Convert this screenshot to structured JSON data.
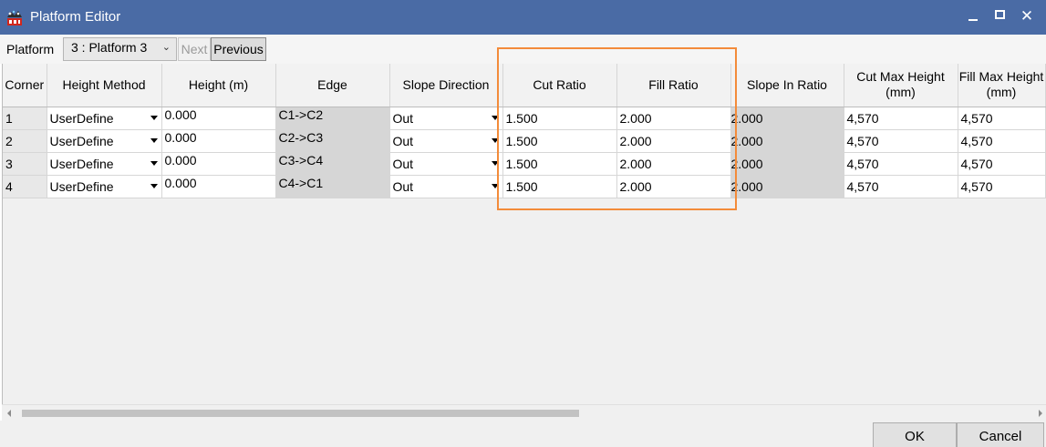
{
  "window": {
    "title": "Platform Editor",
    "close_glyph": "✕",
    "icon": "app-logo-icon"
  },
  "toolbar": {
    "platform_label": "Platform",
    "platform_value": "3 : Platform 3",
    "next_label": "Next",
    "previous_label": "Previous"
  },
  "grid": {
    "columns": [
      "Corner",
      "Height Method",
      "Height (m)",
      "Edge",
      "Slope Direction",
      "Cut Ratio",
      "Fill Ratio",
      "Slope In Ratio",
      "Cut Max Height\n(mm)",
      "Fill Max Height\n(mm)"
    ],
    "rows": [
      {
        "corner": "1",
        "height_method": "UserDefine",
        "height": "0.000",
        "edge": "C1->C2",
        "slope_direction": "Out",
        "cut_ratio": "1.500",
        "fill_ratio": "2.000",
        "slope_in_ratio": "2.000",
        "cut_max_height": "4,570",
        "fill_max_height": "4,570"
      },
      {
        "corner": "2",
        "height_method": "UserDefine",
        "height": "0.000",
        "edge": "C2->C3",
        "slope_direction": "Out",
        "cut_ratio": "1.500",
        "fill_ratio": "2.000",
        "slope_in_ratio": "2.000",
        "cut_max_height": "4,570",
        "fill_max_height": "4,570"
      },
      {
        "corner": "3",
        "height_method": "UserDefine",
        "height": "0.000",
        "edge": "C3->C4",
        "slope_direction": "Out",
        "cut_ratio": "1.500",
        "fill_ratio": "2.000",
        "slope_in_ratio": "2.000",
        "cut_max_height": "4,570",
        "fill_max_height": "4,570"
      },
      {
        "corner": "4",
        "height_method": "UserDefine",
        "height": "0.000",
        "edge": "C4->C1",
        "slope_direction": "Out",
        "cut_ratio": "1.500",
        "fill_ratio": "2.000",
        "slope_in_ratio": "2.000",
        "cut_max_height": "4,570",
        "fill_max_height": "4,570"
      }
    ]
  },
  "footer": {
    "ok_label": "OK",
    "cancel_label": "Cancel"
  },
  "colors": {
    "titlebar": "#4a6ba5",
    "highlight": "#f38b3a",
    "readonly_cell": "#d6d6d6"
  }
}
